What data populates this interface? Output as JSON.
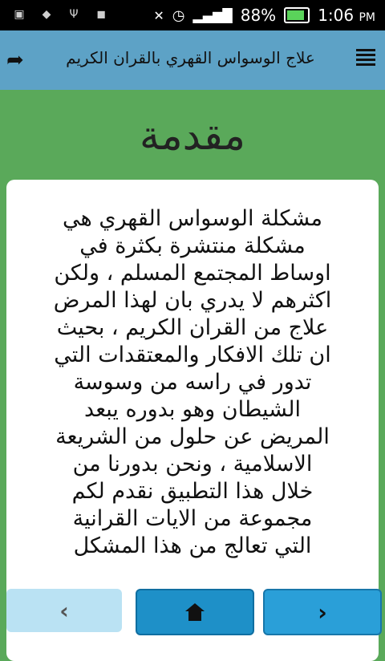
{
  "status_bar": {
    "battery": "88%",
    "time": "1:06",
    "ampm": "PM",
    "battery_level": 0.88
  },
  "app_bar": {
    "title": "علاج الوسواس القهري بالقران الكريم"
  },
  "content": {
    "heading": "مقدمة",
    "paragraph": "مشكلة الوسواس القهري هي\nمشكلة منتشرة بكثرة في\nاوساط المجتمع المسلم ، ولكن\nاكثرهم لا يدري بان لهذا المرض\nعلاج من القران الكريم ، بحيث\nان تلك الافكار والمعتقدات التي\nتدور في راسه من وسوسة\nالشيطان وهو بدوره يبعد\nالمريض عن حلول من الشريعة\nالاسلامية ، ونحن بدورنا من\nخلال هذا التطبيق نقدم لكم\nمجموعة من الايات القرانية\nالتي تعالج من هذا المشكل"
  },
  "nav": {
    "prev_icon": "chevron-left",
    "home_icon": "home",
    "next_icon": "chevron-right"
  }
}
